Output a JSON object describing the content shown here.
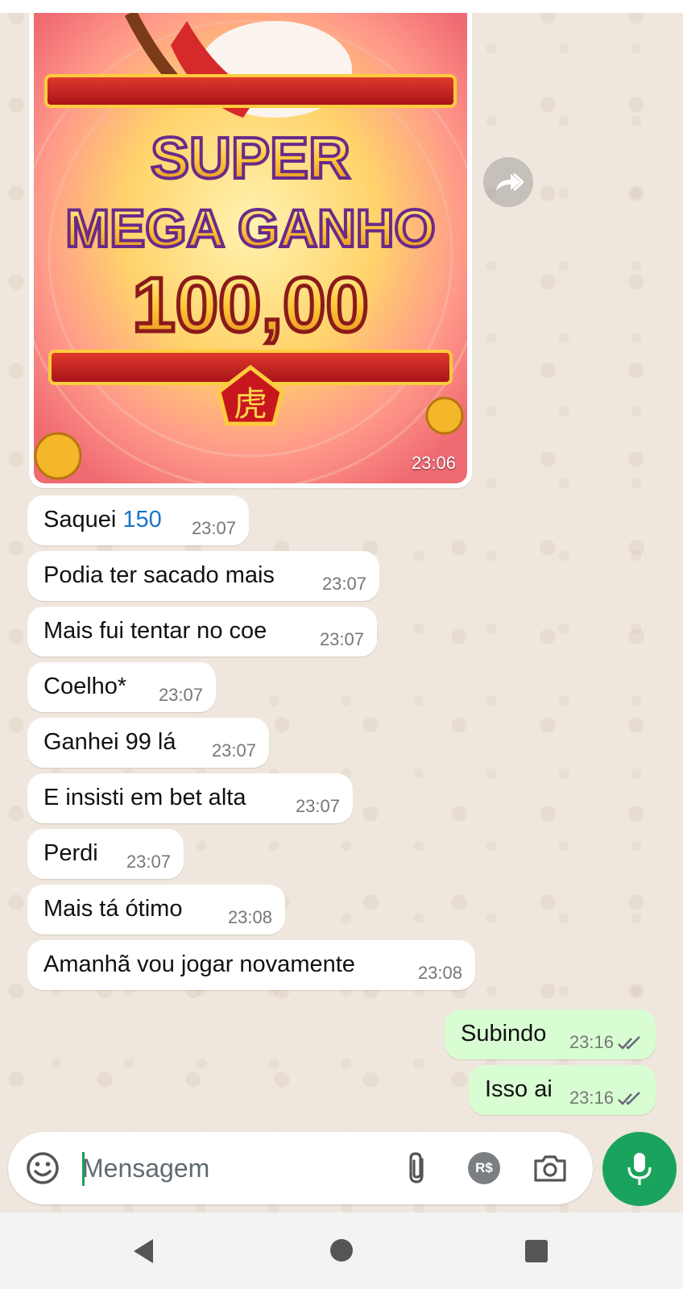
{
  "image_message": {
    "line1": "SUPER",
    "line2": "MEGA GANHO",
    "amount": "100,00",
    "emblem": "虎",
    "time": "23:06"
  },
  "messages": [
    {
      "direction": "in",
      "text": "Saquei ",
      "link": "150",
      "time": "23:07"
    },
    {
      "direction": "in",
      "text": "Podia ter sacado mais",
      "time": "23:07"
    },
    {
      "direction": "in",
      "text": "Mais fui tentar no coe",
      "time": "23:07"
    },
    {
      "direction": "in",
      "text": "Coelho*",
      "time": "23:07"
    },
    {
      "direction": "in",
      "text": "Ganhei 99 lá",
      "time": "23:07"
    },
    {
      "direction": "in",
      "text": "E insisti em bet alta",
      "time": "23:07"
    },
    {
      "direction": "in",
      "text": "Perdi",
      "time": "23:07"
    },
    {
      "direction": "in",
      "text": "Mais tá ótimo",
      "time": "23:08"
    },
    {
      "direction": "in",
      "text": "Amanhã vou jogar novamente",
      "time": "23:08"
    },
    {
      "direction": "out",
      "text": "Subindo",
      "time": "23:16",
      "status": "read"
    },
    {
      "direction": "out",
      "text": "Isso ai",
      "time": "23:16",
      "status": "read"
    }
  ],
  "composer": {
    "placeholder": "Mensagem",
    "payment_label": "R$"
  },
  "colors": {
    "outgoing_bubble": "#d9fdd3",
    "incoming_bubble": "#ffffff",
    "accent": "#1aa35c",
    "link": "#1a73c9"
  }
}
